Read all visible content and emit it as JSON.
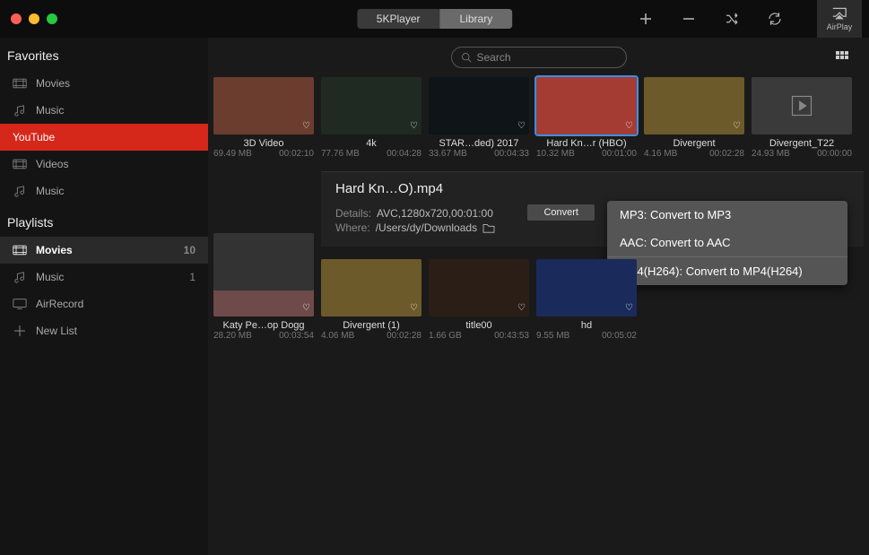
{
  "app": {
    "name": "5KPlayer",
    "library_tab": "Library",
    "airplay_label": "AirPlay"
  },
  "search": {
    "placeholder": "Search"
  },
  "sidebar": {
    "favorites": {
      "head": "Favorites",
      "items": [
        {
          "label": "Movies",
          "icon": "film"
        },
        {
          "label": "Music",
          "icon": "music"
        }
      ]
    },
    "youtube": {
      "label": "YouTube",
      "items": [
        {
          "label": "Videos",
          "icon": "film"
        },
        {
          "label": "Music",
          "icon": "music"
        }
      ]
    },
    "playlists": {
      "head": "Playlists",
      "items": [
        {
          "label": "Movies",
          "icon": "film",
          "count": "10"
        },
        {
          "label": "Music",
          "icon": "music",
          "count": "1"
        },
        {
          "label": "AirRecord",
          "icon": "cast",
          "count": ""
        },
        {
          "label": "New List",
          "icon": "plus",
          "count": ""
        }
      ]
    }
  },
  "grid1": [
    {
      "title": "3D Video",
      "size": "69.49 MB",
      "dur": "00:02:10",
      "bg": "#6b3d2f"
    },
    {
      "title": "4k",
      "size": "77.76 MB",
      "dur": "00:04:28",
      "bg": "#1e2a22"
    },
    {
      "title": "STAR…ded) 2017",
      "size": "33.67 MB",
      "dur": "00:04:33",
      "bg": "#0e1418"
    },
    {
      "title": "Hard Kn…r (HBO)",
      "size": "10.32 MB",
      "dur": "00:01:00",
      "bg": "#a43c34",
      "selected": true
    },
    {
      "title": "Divergent",
      "size": "4.16 MB",
      "dur": "00:02:28",
      "bg": "#6d5a2a"
    },
    {
      "title": "Divergent_T22",
      "size": "24.93 MB",
      "dur": "00:00:00",
      "bg": "#3a3a3a",
      "placeholder": true
    }
  ],
  "detail": {
    "title": "Hard Kn…O).mp4",
    "details_lbl": "Details:",
    "details_val": "AVC,1280x720,00:01:00",
    "where_lbl": "Where:",
    "where_val": "/Users/dy/Downloads",
    "convert_lbl": "Convert",
    "menu": [
      "MP3: Convert to MP3",
      "AAC: Convert to AAC",
      "MP4(H264): Convert to MP4(H264)"
    ]
  },
  "grid2": [
    {
      "title": "Katy Pe…op Dogg",
      "size": "28.20 MB",
      "dur": "00:03:54",
      "bg": "#6e4a4a"
    },
    {
      "title": "Divergent (1)",
      "size": "4.06 MB",
      "dur": "00:02:28",
      "bg": "#6d5a2a"
    },
    {
      "title": "title00",
      "size": "1.66 GB",
      "dur": "00:43:53",
      "bg": "#2a1e16"
    },
    {
      "title": "hd",
      "size": "9.55 MB",
      "dur": "00:05:02",
      "bg": "#1a2a5a"
    }
  ]
}
